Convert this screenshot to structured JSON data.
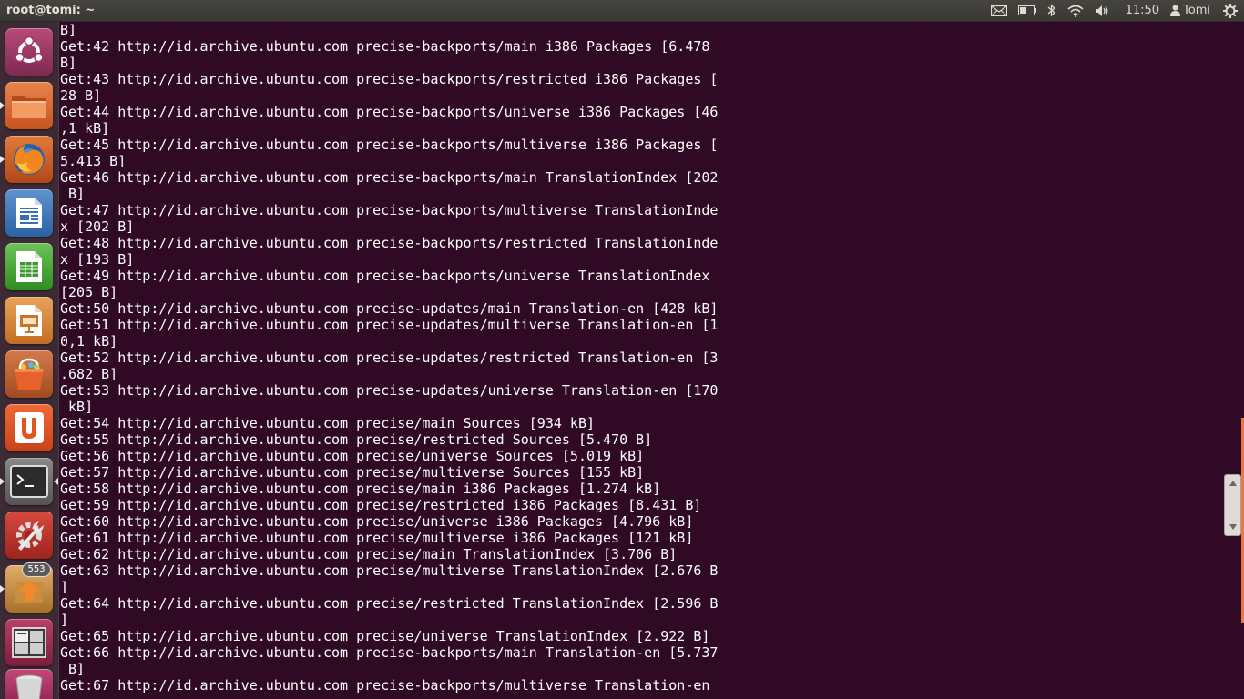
{
  "panel": {
    "window_title": "root@tomi: ~",
    "clock": "11:50",
    "user_name": "Tomi",
    "icons": [
      "mail-icon",
      "battery-icon",
      "bluetooth-icon",
      "wifi-icon",
      "volume-icon",
      "user-icon",
      "session-gear-icon"
    ]
  },
  "launcher": {
    "items": [
      {
        "name": "ubuntu-dash",
        "icon": "ubuntu-logo-icon",
        "running": false
      },
      {
        "name": "files",
        "icon": "folder-icon",
        "running": true
      },
      {
        "name": "firefox",
        "icon": "firefox-icon",
        "running": true
      },
      {
        "name": "libreoffice-writer",
        "icon": "writer-icon",
        "running": false
      },
      {
        "name": "libreoffice-calc",
        "icon": "calc-icon",
        "running": false
      },
      {
        "name": "libreoffice-impress",
        "icon": "impress-icon",
        "running": false
      },
      {
        "name": "software-center",
        "icon": "shopping-bag-icon",
        "running": false
      },
      {
        "name": "ubuntu-one",
        "icon": "ubuntu-one-icon",
        "running": false
      },
      {
        "name": "terminal",
        "icon": "terminal-icon",
        "running": true,
        "active": true
      },
      {
        "name": "system-settings",
        "icon": "settings-wrench-icon",
        "running": false
      },
      {
        "name": "update-manager",
        "icon": "update-arrow-icon",
        "running": true,
        "badge": "553"
      },
      {
        "name": "workspace-switcher",
        "icon": "workspaces-icon",
        "running": false
      },
      {
        "name": "trash",
        "icon": "trash-icon",
        "running": false
      }
    ]
  },
  "colors": {
    "terminal_bg": "#300a24",
    "terminal_fg": "#ffffff",
    "panel_bg": "#3c3b37",
    "accent": "#e8784a"
  },
  "terminal": {
    "lines": [
      "B]",
      "Get:42 http://id.archive.ubuntu.com precise-backports/main i386 Packages [6.478",
      "B]",
      "Get:43 http://id.archive.ubuntu.com precise-backports/restricted i386 Packages [",
      "28 B]",
      "Get:44 http://id.archive.ubuntu.com precise-backports/universe i386 Packages [46",
      ",1 kB]",
      "Get:45 http://id.archive.ubuntu.com precise-backports/multiverse i386 Packages [",
      "5.413 B]",
      "Get:46 http://id.archive.ubuntu.com precise-backports/main TranslationIndex [202",
      " B]",
      "Get:47 http://id.archive.ubuntu.com precise-backports/multiverse TranslationInde",
      "x [202 B]",
      "Get:48 http://id.archive.ubuntu.com precise-backports/restricted TranslationInde",
      "x [193 B]",
      "Get:49 http://id.archive.ubuntu.com precise-backports/universe TranslationIndex",
      "[205 B]",
      "Get:50 http://id.archive.ubuntu.com precise-updates/main Translation-en [428 kB]",
      "Get:51 http://id.archive.ubuntu.com precise-updates/multiverse Translation-en [1",
      "0,1 kB]",
      "Get:52 http://id.archive.ubuntu.com precise-updates/restricted Translation-en [3",
      ".682 B]",
      "Get:53 http://id.archive.ubuntu.com precise-updates/universe Translation-en [170",
      " kB]",
      "Get:54 http://id.archive.ubuntu.com precise/main Sources [934 kB]",
      "Get:55 http://id.archive.ubuntu.com precise/restricted Sources [5.470 B]",
      "Get:56 http://id.archive.ubuntu.com precise/universe Sources [5.019 kB]",
      "Get:57 http://id.archive.ubuntu.com precise/multiverse Sources [155 kB]",
      "Get:58 http://id.archive.ubuntu.com precise/main i386 Packages [1.274 kB]",
      "Get:59 http://id.archive.ubuntu.com precise/restricted i386 Packages [8.431 B]",
      "Get:60 http://id.archive.ubuntu.com precise/universe i386 Packages [4.796 kB]",
      "Get:61 http://id.archive.ubuntu.com precise/multiverse i386 Packages [121 kB]",
      "Get:62 http://id.archive.ubuntu.com precise/main TranslationIndex [3.706 B]",
      "Get:63 http://id.archive.ubuntu.com precise/multiverse TranslationIndex [2.676 B",
      "]",
      "Get:64 http://id.archive.ubuntu.com precise/restricted TranslationIndex [2.596 B",
      "]",
      "Get:65 http://id.archive.ubuntu.com precise/universe TranslationIndex [2.922 B]",
      "Get:66 http://id.archive.ubuntu.com precise-backports/main Translation-en [5.737",
      " B]",
      "Get:67 http://id.archive.ubuntu.com precise-backports/multiverse Translation-en"
    ]
  }
}
